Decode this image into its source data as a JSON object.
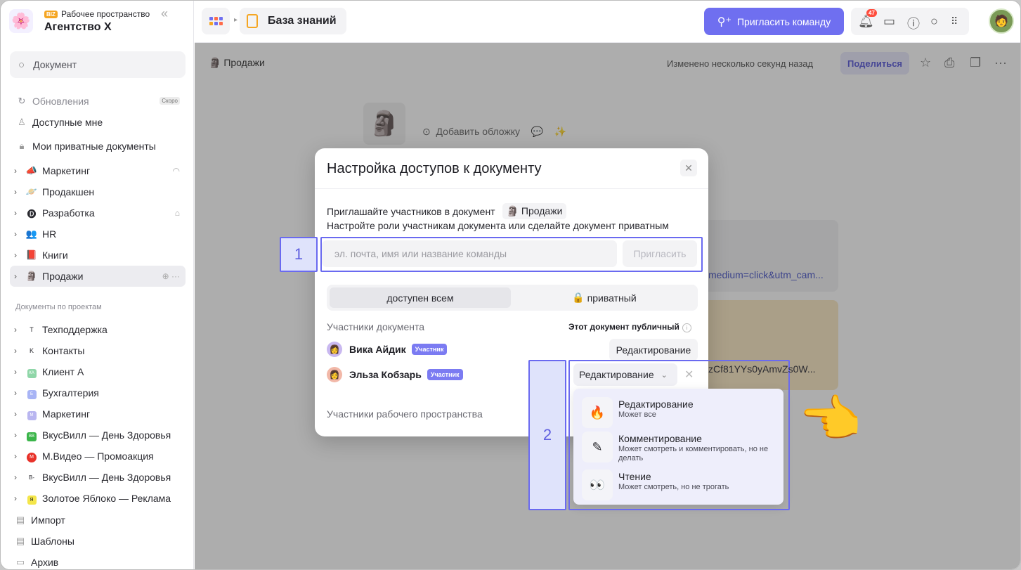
{
  "workspace": {
    "badge": "BIZ",
    "subtitle": "Рабочее пространство",
    "name": "Агентство Х",
    "logo_icon": "flower-face-icon"
  },
  "sidebar": {
    "search_placeholder": "Документ",
    "updates": {
      "label": "Обновления",
      "soon": "Скоро"
    },
    "shared": "Доступные мне",
    "private_docs": "Мои приватные документы",
    "spaces": [
      {
        "label": "Маркетинг",
        "icon": "megaphone-icon"
      },
      {
        "label": "Продакшен",
        "icon": "planet-icon"
      },
      {
        "label": "Разработка",
        "icon": "code-icon"
      },
      {
        "label": "HR",
        "icon": "people-icon"
      },
      {
        "label": "Книги",
        "icon": "book-icon"
      },
      {
        "label": "Продажи",
        "icon": "moai-icon"
      }
    ],
    "projects_header": "Документы по проектам",
    "projects": [
      {
        "label": "Техподдержка",
        "mark": "T"
      },
      {
        "label": "Контакты",
        "mark": "K"
      },
      {
        "label": "Клиент А",
        "mark": "КА"
      },
      {
        "label": "Бухгалтерия",
        "mark": "Б"
      },
      {
        "label": "Маркетинг",
        "mark": "М"
      },
      {
        "label": "ВкусВилл — День Здоровья",
        "mark": "BB"
      },
      {
        "label": "М.Видео — Промоакция",
        "mark": "М"
      },
      {
        "label": "ВкусВилл — День Здоровья",
        "mark": "B-"
      },
      {
        "label": "Золотое Яблоко — Реклама",
        "mark": "Я"
      }
    ],
    "import": "Импорт",
    "templates": "Шаблоны",
    "archive": "Архив"
  },
  "topbar": {
    "breadcrumb": "База знаний",
    "invite_team": "Пригласить команду",
    "notifications_count": "47"
  },
  "document": {
    "breadcrumb": "Продажи",
    "changed": "Изменено несколько секунд назад",
    "share": "Поделиться",
    "add_cover": "Добавить обложку",
    "bg_link1": "medium=click&utm_cam...",
    "bg_link2": "zCf81YYs0yAmvZs0W..."
  },
  "modal": {
    "title": "Настройка доступов к документу",
    "invite_line": "Приглашайте участников в документ",
    "doc_chip": "Продажи",
    "roles_line": "Настройте роли участникам документа или сделайте документ приватным",
    "input_placeholder": "эл. почта, имя или название команды",
    "invite_button": "Пригласить",
    "access_public": "доступен всем",
    "access_private": "приватный",
    "members_header": "Участники документа",
    "public_note": "Этот документ публичный",
    "members": [
      {
        "name": "Вика Айдик",
        "role_tag": "Участник",
        "role": "Редактирование"
      },
      {
        "name": "Эльза Кобзарь",
        "role_tag": "Участник",
        "role": "Редактирование"
      }
    ],
    "workspace_members": "Участники рабочего пространства"
  },
  "role_dropdown": {
    "options": [
      {
        "title": "Редактирование",
        "desc": "Может все",
        "icon": "fire-icon"
      },
      {
        "title": "Комментирование",
        "desc": "Может смотреть и комментировать, но не делать",
        "icon": "pencil-icon"
      },
      {
        "title": "Чтение",
        "desc": "Может смотреть, но не трогать",
        "icon": "eyes-icon"
      }
    ]
  },
  "annotations": {
    "label1": "1",
    "label2": "2"
  },
  "colors": {
    "accent": "#6f6ff0",
    "badge": "#ff4d3d",
    "tag": "#7b7bf2",
    "annotation": "#6a6af0"
  }
}
